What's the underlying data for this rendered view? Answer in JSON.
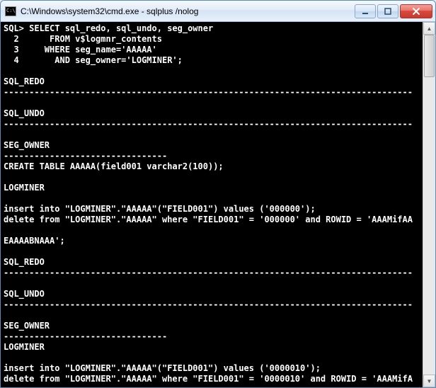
{
  "window": {
    "title": "C:\\Windows\\system32\\cmd.exe - sqlplus  /nolog"
  },
  "console": {
    "lines": [
      "SQL> SELECT sql_redo, sql_undo, seg_owner",
      "  2      FROM v$logmnr_contents",
      "  3     WHERE seg_name='AAAAA'",
      "  4       AND seg_owner='LOGMINER';",
      "",
      "SQL_REDO",
      "--------------------------------------------------------------------------------",
      "",
      "SQL_UNDO",
      "--------------------------------------------------------------------------------",
      "",
      "SEG_OWNER",
      "--------------------------------",
      "CREATE TABLE AAAAA(field001 varchar2(100));",
      "",
      "LOGMINER",
      "",
      "insert into \"LOGMINER\".\"AAAAA\"(\"FIELD001\") values ('000000');",
      "delete from \"LOGMINER\".\"AAAAA\" where \"FIELD001\" = '000000' and ROWID = 'AAAMifAA",
      "",
      "EAAAABNAAA';",
      "",
      "SQL_REDO",
      "--------------------------------------------------------------------------------",
      "",
      "SQL_UNDO",
      "--------------------------------------------------------------------------------",
      "",
      "SEG_OWNER",
      "--------------------------------",
      "LOGMINER",
      "",
      "insert into \"LOGMINER\".\"AAAAA\"(\"FIELD001\") values ('0000010');",
      "delete from \"LOGMINER\".\"AAAAA\" where \"FIELD001\" = '0000010' and ROWID = 'AAAMifA"
    ]
  }
}
